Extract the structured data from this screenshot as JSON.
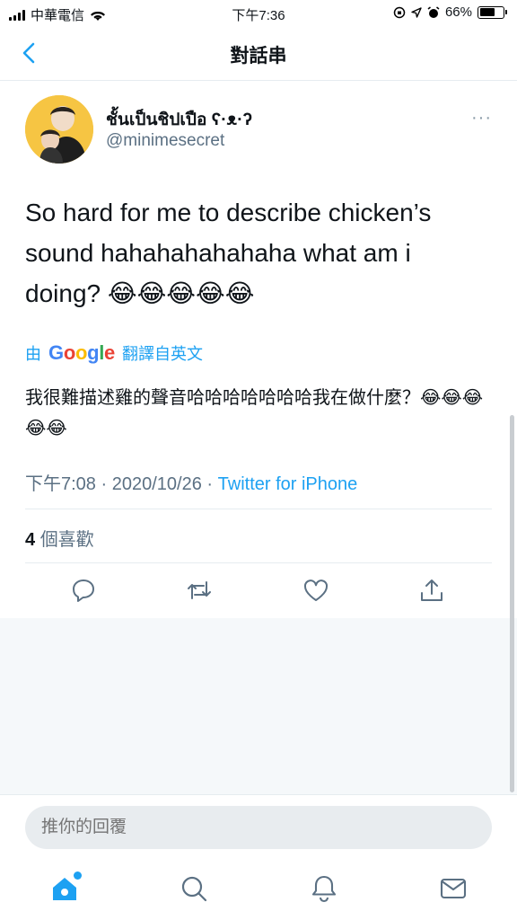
{
  "status_bar": {
    "carrier": "中華電信",
    "time": "下午7:36",
    "battery": "66%",
    "battery_level": 0.66
  },
  "header": {
    "title": "對話串",
    "back_icon": "chevron-left-icon"
  },
  "tweet": {
    "display_name": "ชั้นเป็นชิปเปือ ʕ·ᴥ·ʔ",
    "handle": "@minimesecret",
    "more": "···",
    "text": "So hard for me to describe chicken’s sound hahahahahahaha what am i doing? 😂😂😂😂😂",
    "translate": {
      "by": "由",
      "provider": "Google",
      "label": "翻譯自英文"
    },
    "translated_text": "我很難描述雞的聲音哈哈哈哈哈哈哈我在做什麼？😂😂😂😂😂",
    "time": "下午7:08",
    "date": "2020/10/26",
    "source": "Twitter for iPhone",
    "separator": "·",
    "likes_count": "4",
    "likes_label": "個喜歡"
  },
  "actions": [
    "reply-icon",
    "retweet-icon",
    "like-icon",
    "share-icon"
  ],
  "reply": {
    "placeholder": "推你的回覆"
  },
  "tabs": [
    "home-icon",
    "search-icon",
    "notifications-icon",
    "messages-icon"
  ],
  "colors": {
    "accent": "#1da1f2",
    "text": "#0f1419",
    "secondary": "#5b7083",
    "background_gray": "#f5f8fa"
  }
}
